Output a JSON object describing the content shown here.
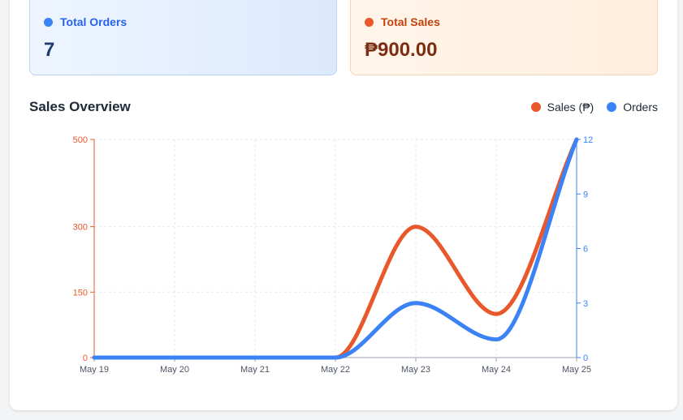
{
  "stats": {
    "orders": {
      "label": "Total Orders",
      "value": "7",
      "color": "#3b82f6"
    },
    "sales": {
      "label": "Total Sales",
      "value": "₱900.00",
      "color": "#e8582b"
    }
  },
  "section_title": "Sales Overview",
  "legend": [
    {
      "label": "Sales (₱)",
      "color": "#e8582b"
    },
    {
      "label": "Orders",
      "color": "#3b82f6"
    }
  ],
  "chart_data": {
    "type": "line",
    "title": "Sales Overview",
    "categories": [
      "May 19",
      "May 20",
      "May 21",
      "May 22",
      "May 23",
      "May 24",
      "May 25"
    ],
    "series": [
      {
        "name": "Sales (₱)",
        "axis": "left",
        "color": "#e8582b",
        "values": [
          0,
          0,
          0,
          0,
          300,
          100,
          500
        ]
      },
      {
        "name": "Orders",
        "axis": "right",
        "color": "#3b82f6",
        "values": [
          0,
          0,
          0,
          0,
          3,
          1,
          12
        ]
      }
    ],
    "y_left": {
      "ticks": [
        "0",
        "150",
        "300",
        "500"
      ],
      "tick_values": [
        0,
        150,
        300,
        500
      ],
      "range": [
        0,
        500
      ],
      "color": "#e8582b"
    },
    "y_right": {
      "ticks": [
        "0",
        "3",
        "6",
        "9",
        "12"
      ],
      "tick_values": [
        0,
        3,
        6,
        9,
        12
      ],
      "range": [
        0,
        12
      ],
      "color": "#3b82f6"
    },
    "grid": true,
    "legend_position": "top-right"
  }
}
